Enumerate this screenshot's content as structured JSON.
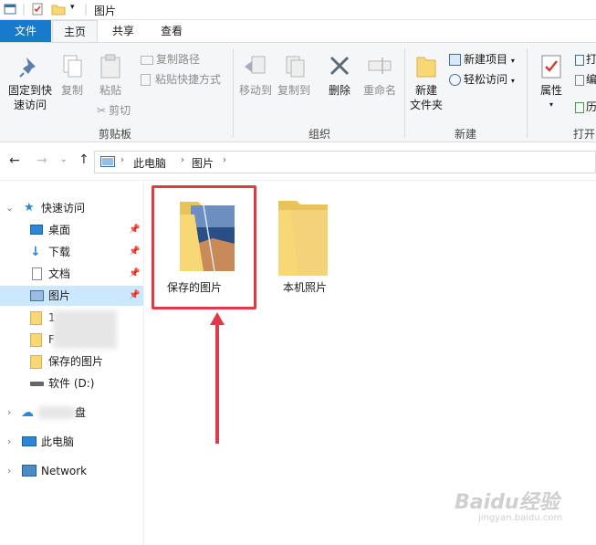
{
  "window": {
    "title": "图片"
  },
  "tabs": {
    "file": "文件",
    "home": "主页",
    "share": "共享",
    "view": "查看"
  },
  "ribbon": {
    "pin_quick_access": [
      "固定到快",
      "速访问"
    ],
    "copy": "复制",
    "paste": "粘贴",
    "copy_path": "复制路径",
    "paste_shortcut": "粘贴快捷方式",
    "cut": "剪切",
    "clipboard_group": "剪贴板",
    "move_to": "移动到",
    "copy_to": "复制到",
    "delete": "删除",
    "rename": "重命名",
    "organize_group": "组织",
    "new_folder": [
      "新建",
      "文件夹"
    ],
    "new_item": "新建项目",
    "easy_access": "轻松访问",
    "new_group": "新建",
    "properties": "属性",
    "open_group": "打开",
    "open_partial": [
      "打",
      "编",
      "历"
    ]
  },
  "address": {
    "crumbs": [
      "此电脑",
      "图片"
    ]
  },
  "nav": {
    "quick_access": "快速访问",
    "desktop": "桌面",
    "downloads": "下载",
    "documents": "文档",
    "pictures": "图片",
    "item_1": "1",
    "item_f": "F",
    "saved_pictures": "保存的图片",
    "software_d": "软件 (D:)",
    "onedrive_partial": "盘",
    "this_pc": "此电脑",
    "network": "Network"
  },
  "content": {
    "folders": [
      "保存的图片",
      "本机照片"
    ]
  },
  "watermark": {
    "brand": "Baidu经验",
    "url": "jingyan.baidu.com"
  },
  "colors": {
    "accent": "#1979ca",
    "highlight": "#e03a48",
    "selected": "#cce8ff",
    "folder": "#f8d775"
  }
}
